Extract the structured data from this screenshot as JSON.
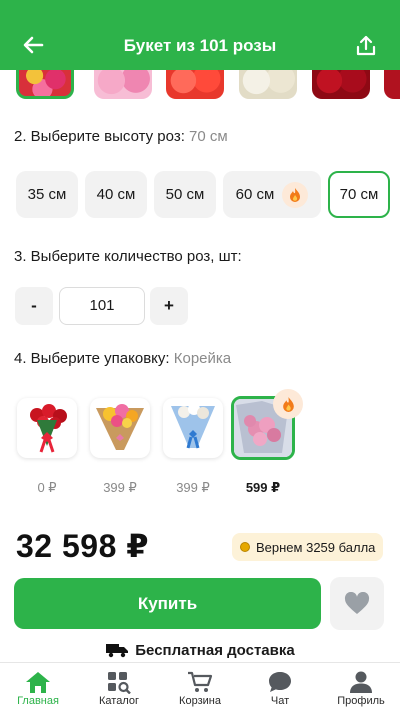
{
  "header": {
    "title": "Букет из 101 розы",
    "back_icon": "arrow-left-icon",
    "share_icon": "share-icon"
  },
  "colors": {
    "accent": "#2db34a",
    "muted": "#8a8a8a",
    "chip_bg": "#f2f2f2",
    "bonus_bg": "#fdf2d8"
  },
  "height": {
    "label": "2. Выберите высоту роз:",
    "selected": "70 см",
    "options": [
      "35 см",
      "40 см",
      "50 см",
      "60 см",
      "70 см"
    ]
  },
  "quantity": {
    "label": "3. Выберите количество роз, шт:",
    "minus": "-",
    "value": "101",
    "plus": "+"
  },
  "packaging": {
    "label": "4. Выберите упаковку:",
    "selected": "Корейка",
    "prices": [
      "0 ₽",
      "399 ₽",
      "399 ₽",
      "599 ₽"
    ]
  },
  "total": "32 598 ₽",
  "bonus": "Вернем 3259 балла",
  "buy_label": "Купить",
  "delivery": "Бесплатная доставка",
  "nav": [
    {
      "label": "Главная",
      "icon": "home-icon"
    },
    {
      "label": "Каталог",
      "icon": "catalog-icon"
    },
    {
      "label": "Корзина",
      "icon": "cart-icon"
    },
    {
      "label": "Чат",
      "icon": "chat-icon"
    },
    {
      "label": "Профиль",
      "icon": "profile-icon"
    }
  ]
}
